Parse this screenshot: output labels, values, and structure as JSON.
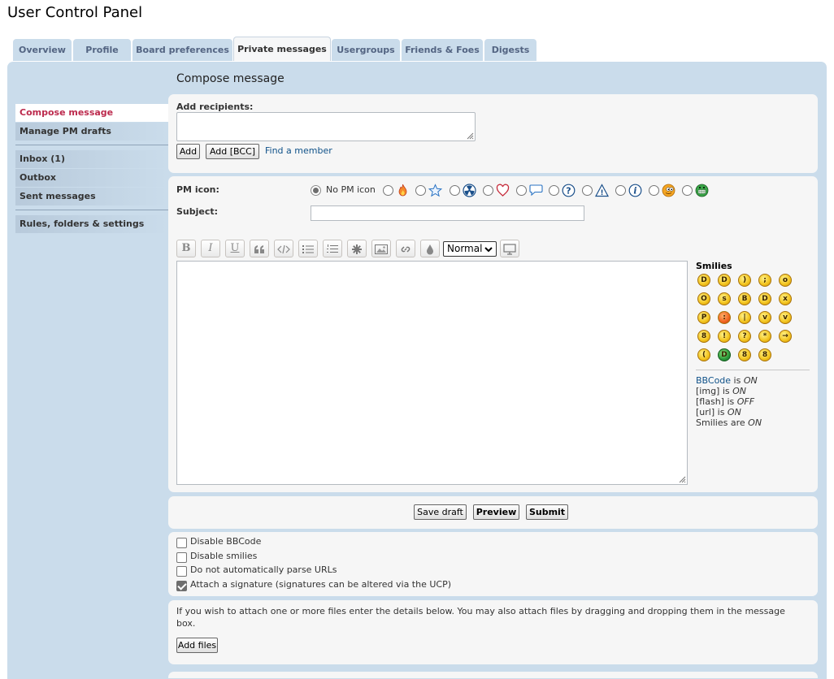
{
  "page": {
    "title": "User Control Panel"
  },
  "tabs": [
    {
      "label": "Overview"
    },
    {
      "label": "Profile"
    },
    {
      "label": "Board preferences"
    },
    {
      "label": "Private messages"
    },
    {
      "label": "Usergroups"
    },
    {
      "label": "Friends & Foes"
    },
    {
      "label": "Digests"
    }
  ],
  "active_tab": "Private messages",
  "sidebar": {
    "items": [
      {
        "label": "Compose message"
      },
      {
        "label": "Manage PM drafts"
      },
      {
        "label": "Inbox (1)"
      },
      {
        "label": "Outbox"
      },
      {
        "label": "Sent messages"
      },
      {
        "label": "Rules, folders & settings"
      }
    ],
    "active_item": "Compose message"
  },
  "compose": {
    "heading": "Compose message",
    "recipients": {
      "label": "Add recipients:",
      "value": "",
      "add_button": "Add",
      "add_bcc_button": "Add [BCC]",
      "find_member_link": "Find a member"
    },
    "pm_icon": {
      "label": "PM icon:",
      "no_icon_label": "No PM icon",
      "selected": "No PM icon",
      "icons": [
        "fire-icon",
        "star-icon",
        "radioactive-icon",
        "heart-icon",
        "speech-bubble-icon",
        "question-icon",
        "warning-icon",
        "info-icon",
        "mrgreen-face-icon",
        "grin-face-icon"
      ]
    },
    "subject": {
      "label": "Subject:",
      "value": ""
    },
    "toolbar": {
      "buttons": [
        "B",
        "I",
        "U",
        "quote",
        "code",
        "list",
        "list-numbered",
        "list-item",
        "image",
        "link",
        "color"
      ],
      "font_size": "Normal"
    },
    "message": {
      "value": ""
    },
    "smilies": {
      "title": "Smilies",
      "rows": [
        [
          "biggrin",
          "grin",
          "smile",
          "wink",
          "surprised"
        ],
        [
          "eek",
          "confused",
          "cool",
          "lol",
          "mad"
        ],
        [
          "razz",
          "redface",
          "neutral",
          "twisted",
          "evil"
        ],
        [
          "e_geek",
          "exclaim",
          "question",
          "idea",
          "arrow"
        ],
        [
          "sad",
          "mrgreen",
          "geek",
          "ugeek"
        ]
      ]
    },
    "status": [
      {
        "key": "BBCode",
        "text": " is ",
        "value": "ON",
        "link": true
      },
      {
        "key": "[img]",
        "text": " is ",
        "value": "ON",
        "link": false
      },
      {
        "key": "[flash]",
        "text": " is ",
        "value": "OFF",
        "link": false
      },
      {
        "key": "[url]",
        "text": " is ",
        "value": "ON",
        "link": false
      },
      {
        "key": "Smilies",
        "text": " are ",
        "value": "ON",
        "link": false
      }
    ],
    "actions": {
      "save_draft": "Save draft",
      "preview": "Preview",
      "submit": "Submit"
    },
    "options": [
      {
        "label": "Disable BBCode",
        "checked": false
      },
      {
        "label": "Disable smilies",
        "checked": false
      },
      {
        "label": "Do not automatically parse URLs",
        "checked": false
      },
      {
        "label": "Attach a signature (signatures can be altered via the UCP)",
        "checked": true
      }
    ],
    "attachments": {
      "help": "If you wish to attach one or more files enter the details below. You may also attach files by dragging and dropping them in the message box.",
      "add_files_button": "Add files"
    }
  }
}
